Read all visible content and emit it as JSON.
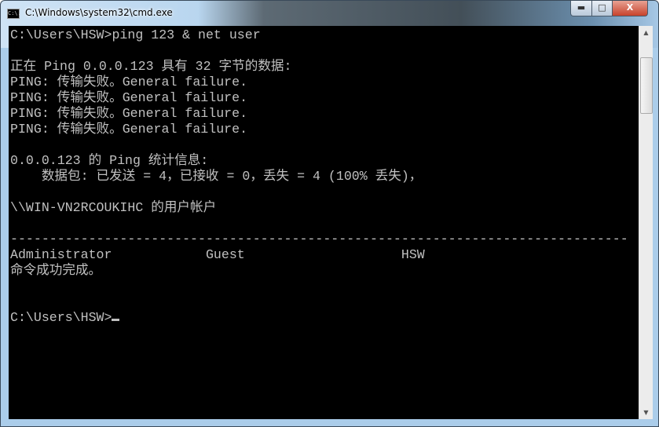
{
  "window": {
    "title": "C:\\Windows\\system32\\cmd.exe",
    "icon": "cmd-icon",
    "icon_text": "C:\\.",
    "minimize_label": "▬",
    "maximize_label": "□",
    "close_label": "X"
  },
  "console": {
    "lines": [
      "C:\\Users\\HSW>ping 123 & net user",
      "",
      "正在 Ping 0.0.0.123 具有 32 字节的数据:",
      "PING: 传输失败。General failure.",
      "PING: 传输失败。General failure.",
      "PING: 传输失败。General failure.",
      "PING: 传输失败。General failure.",
      "",
      "0.0.0.123 的 Ping 统计信息:",
      "    数据包: 已发送 = 4，已接收 = 0，丢失 = 4 (100% 丢失)，",
      "",
      "\\\\WIN-VN2RCOUKIHC 的用户帐户",
      "",
      "-------------------------------------------------------------------------------",
      "Administrator            Guest                    HSW",
      "命令成功完成。",
      "",
      "",
      "C:\\Users\\HSW>"
    ]
  },
  "scrollbar": {
    "up": "▲",
    "down": "▼"
  }
}
